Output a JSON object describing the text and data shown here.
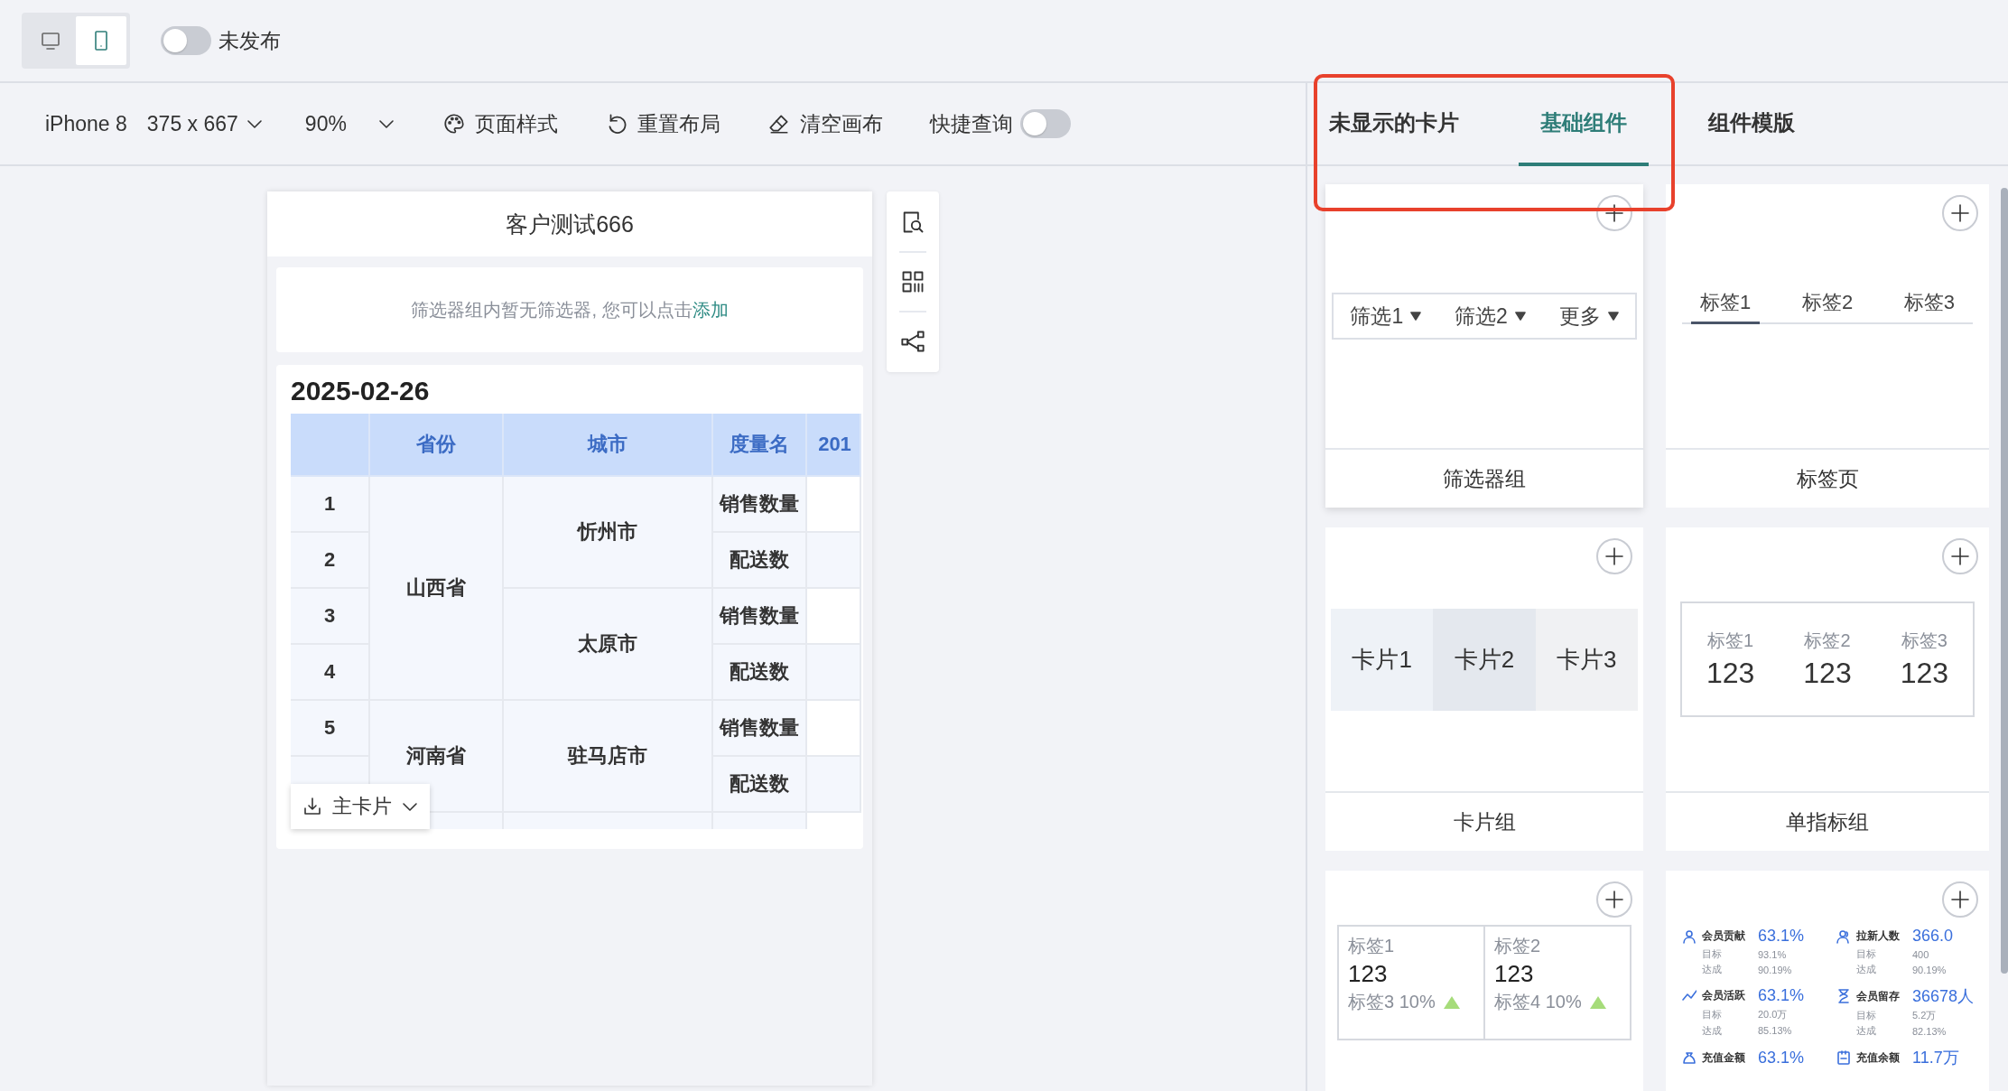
{
  "top_bar": {
    "view_modes": [
      {
        "kind": "desktop",
        "selected": false
      },
      {
        "kind": "mobile",
        "selected": true
      }
    ],
    "publish_switch": {
      "label": "未发布",
      "on": false
    }
  },
  "toolbar": {
    "device": "iPhone 8",
    "resolution": "375 x 667",
    "zoom": "90%",
    "actions": [
      {
        "kind": "palette",
        "label": "页面样式"
      },
      {
        "kind": "undo",
        "label": "重置布局"
      },
      {
        "kind": "eraser",
        "label": "清空画布"
      }
    ],
    "quick_query": {
      "label": "快捷查询",
      "on": false
    }
  },
  "phone": {
    "title": "客户测试666",
    "filter_notice": "筛选器组内暂无筛选器, 您可以点击",
    "filter_link": "添加",
    "table": {
      "title": "2025-02-26",
      "columns": [
        "省份",
        "城市",
        "度量名",
        "201"
      ],
      "provinces": [
        {
          "name": "山西省",
          "cities": [
            {
              "name": "忻州市",
              "rows": [
                {
                  "index": "1",
                  "measure": "销售数量"
                },
                {
                  "index": "2",
                  "measure": "配送数"
                }
              ]
            },
            {
              "name": "太原市",
              "rows": [
                {
                  "index": "3",
                  "measure": "销售数量"
                },
                {
                  "index": "4",
                  "measure": "配送数"
                }
              ]
            }
          ]
        },
        {
          "name": "河南省",
          "cities": [
            {
              "name": "驻马店市",
              "rows": [
                {
                  "index": "5",
                  "measure": "销售数量"
                },
                {
                  "measure": "配送数"
                }
              ]
            }
          ]
        }
      ]
    },
    "card_menu": "主卡片"
  },
  "side_tools": [
    {
      "kind": "preview"
    },
    {
      "kind": "grid"
    },
    {
      "kind": "share"
    }
  ],
  "panel": {
    "tabs": [
      {
        "label": "未显示的卡片",
        "selected": false
      },
      {
        "label": "基础组件",
        "selected": true
      },
      {
        "label": "组件模版",
        "selected": false
      }
    ],
    "cards": [
      {
        "kind": "filter_group",
        "title": "筛选器组",
        "filters": [
          "筛选1",
          "筛选2",
          "更多"
        ]
      },
      {
        "kind": "tabs",
        "title": "标签页",
        "tabs": [
          {
            "label": "标签1",
            "selected": true
          },
          {
            "label": "标签2",
            "selected": false
          },
          {
            "label": "标签3",
            "selected": false
          }
        ]
      },
      {
        "kind": "card_group",
        "title": "卡片组",
        "blocks": [
          {
            "label": "卡片1",
            "color": "#eef2f7"
          },
          {
            "label": "卡片2",
            "color": "#e4e8ee"
          },
          {
            "label": "卡片3",
            "color": "#f0f1f3"
          }
        ]
      },
      {
        "kind": "indicator_group",
        "title": "单指标组",
        "items": [
          {
            "label": "标签1",
            "value": "123"
          },
          {
            "label": "标签2",
            "value": "123"
          },
          {
            "label": "标签3",
            "value": "123"
          }
        ]
      },
      {
        "kind": "compare_indicator",
        "boxes": [
          {
            "label": "标签1",
            "value": "123",
            "sub": "标签3 10%",
            "rising": true
          },
          {
            "label": "标签2",
            "value": "123",
            "sub": "标签4 10%",
            "rising": true
          }
        ]
      },
      {
        "kind": "metric_list",
        "metrics": [
          {
            "kind": "person",
            "name": "会员贡献",
            "value": "63.1%",
            "target_label": "目标",
            "target": "93.1%",
            "rate_label": "达成",
            "rate": "90.19%"
          },
          {
            "kind": "people",
            "name": "拉新人数",
            "value": "366.0",
            "target_label": "目标",
            "target": "400",
            "rate_label": "达成",
            "rate": "90.19%"
          },
          {
            "kind": "trend",
            "name": "会员活跃",
            "value": "63.1%",
            "target_label": "目标",
            "target": "20.0万",
            "rate_label": "达成",
            "rate": "85.13%"
          },
          {
            "kind": "hourglass",
            "name": "会员留存",
            "value": "36678人",
            "target_label": "目标",
            "target": "5.2万",
            "rate_label": "达成",
            "rate": "82.13%"
          },
          {
            "kind": "bag",
            "name": "充值金额",
            "value": "63.1%"
          },
          {
            "kind": "document",
            "name": "充值余额",
            "value": "11.7万"
          }
        ]
      }
    ]
  }
}
